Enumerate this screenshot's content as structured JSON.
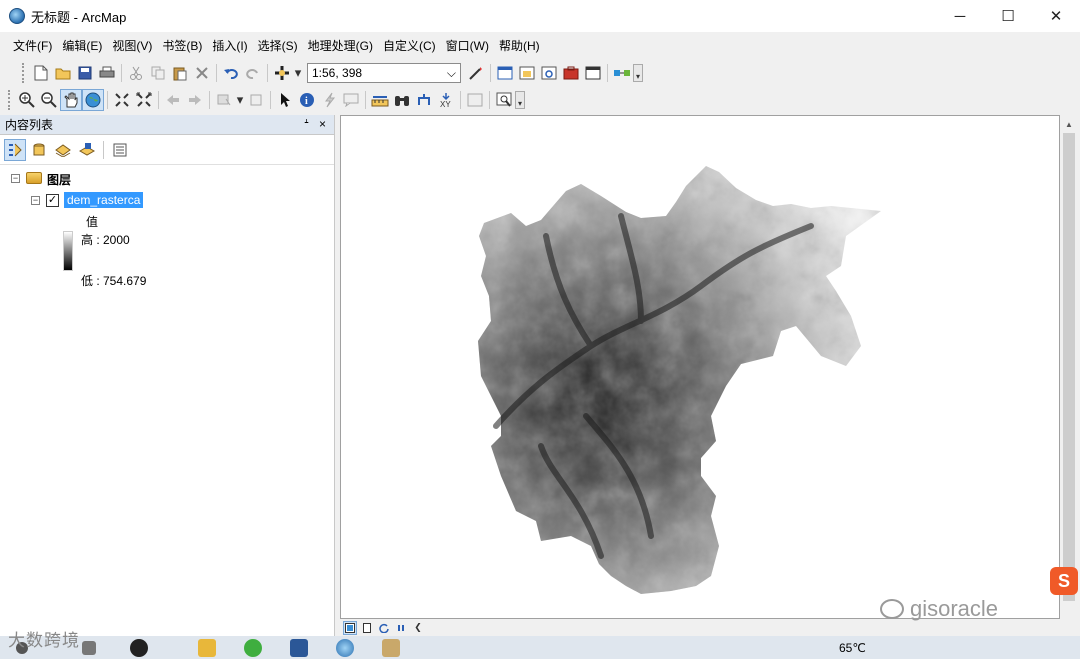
{
  "window": {
    "title": "无标题 - ArcMap",
    "minimize": "─",
    "maximize": "☐",
    "close": "✕"
  },
  "menu": [
    "文件(F)",
    "编辑(E)",
    "视图(V)",
    "书签(B)",
    "插入(I)",
    "选择(S)",
    "地理处理(G)",
    "自定义(C)",
    "窗口(W)",
    "帮助(H)"
  ],
  "toolbar": {
    "scale_value": "1:56, 398",
    "dropdown_arrow": "⌵",
    "overflow": "▾"
  },
  "toc": {
    "title": "内容列表",
    "pin": "ᗮ",
    "close": "×",
    "root_label": "图层",
    "layer_name": "dem_rasterca",
    "check": "✓",
    "legend_title": "值",
    "high_label": "高 : 2000",
    "low_label": "低 : 754.679",
    "expand_minus": "−"
  },
  "mapbar": {
    "prev": "❮"
  },
  "taskbar": {
    "weather": "65℃"
  },
  "watermarks": {
    "left": "大数跨境",
    "right": "gisoracle",
    "sogou": "S"
  },
  "colors": {
    "selected": "#3399ff",
    "toc_header": "#dfe7f1",
    "taskbar": "#dfe6ee"
  }
}
